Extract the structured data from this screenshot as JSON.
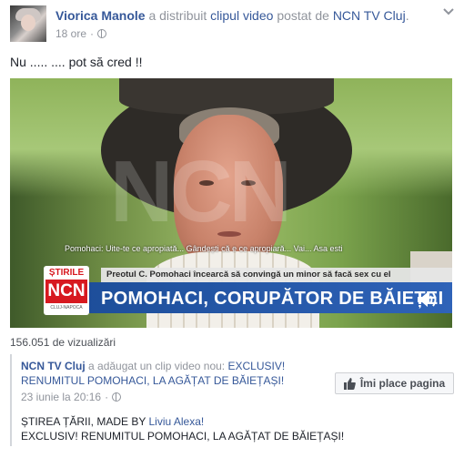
{
  "post": {
    "author": "Viorica Manole",
    "action_text": "a distribuit",
    "object_link": "clipul video",
    "posted_by_text": "postat de",
    "source_page": "NCN TV Cluj",
    "period": ".",
    "timestamp": "18 ore",
    "separator": "·",
    "icons": {
      "privacy": "globe-icon",
      "menu": "chevron-down-icon"
    },
    "message": "Nu ..... .... pot să cred !!"
  },
  "video": {
    "watermark": "NCN",
    "subtitle": "Pomohaci: Uite-te ce apropiată... Gândești că e ce apropiară... Vai... Asa esti",
    "lower_third_top": "Preotul C. Pomohaci încearcă să convingă un minor să facă sex cu el",
    "lower_third_main": "POMOHACI, CORUPĂTOR DE BĂIEȚEI",
    "brand_top": "ȘTIRILE",
    "brand_mid": "NCN",
    "brand_bottom": "CLUJ-NAPOCA",
    "volume_icon": "volume-icon"
  },
  "views": "156.051 de vizualizări",
  "shared": {
    "page": "NCN TV Cluj",
    "action": "a adăugat un clip video nou:",
    "title_link": "EXCLUSIV! RENUMITUL POMOHACI, LA AGĂȚAT DE BĂIEȚAȘI!",
    "date": "23 iunie la 20:16",
    "separator": "·",
    "like_button": "Îmi place pagina",
    "body_line1_prefix": "ȘTIREA ȚĂRII, MADE BY",
    "body_line1_link": "Liviu Alexa!",
    "body_line2": "EXCLUSIV! RENUMITUL POMOHACI, LA AGĂȚAT DE BĂIEȚAȘI!"
  },
  "colors": {
    "link": "#365899",
    "meta": "#90949c",
    "banner": "#2f63b8",
    "brand_red": "#d71920"
  }
}
